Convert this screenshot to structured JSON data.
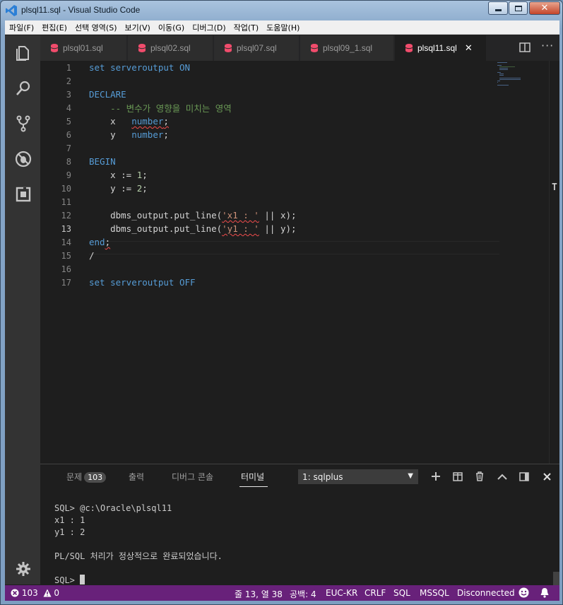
{
  "window": {
    "title": "plsql11.sql - Visual Studio Code"
  },
  "menu": [
    "파일(F)",
    "편집(E)",
    "선택 영역(S)",
    "보기(V)",
    "이동(G)",
    "디버그(D)",
    "작업(T)",
    "도움말(H)"
  ],
  "tabs": [
    {
      "label": "plsql01.sql"
    },
    {
      "label": "plsql02.sql"
    },
    {
      "label": "plsql07.sql"
    },
    {
      "label": "plsql09_1.sql"
    },
    {
      "label": "plsql11.sql",
      "close": "✕"
    }
  ],
  "editor": {
    "current_line": 13,
    "line_numbers": [
      "1",
      "2",
      "3",
      "4",
      "5",
      "6",
      "7",
      "8",
      "9",
      "10",
      "11",
      "12",
      "13",
      "14",
      "15",
      "16",
      "17"
    ],
    "l1": {
      "a": "set serveroutput ",
      "b": "ON"
    },
    "l3": "DECLARE",
    "l4": "-- 변수가 영향을 미치는 영역",
    "l5": {
      "a": "x   ",
      "b": "number",
      "c": ";"
    },
    "l6": {
      "a": "y   ",
      "b": "number",
      "c": ";"
    },
    "l8": "BEGIN",
    "l9": {
      "a": "x := ",
      "b": "1",
      "c": ";"
    },
    "l10": {
      "a": "y := ",
      "b": "2",
      "c": ";"
    },
    "l12": {
      "a": "dbms_output.put_line(",
      "b": "'x1 : '",
      "c": " || x);"
    },
    "l13": {
      "a": "dbms_output.put_line(",
      "b": "'y1 : '",
      "c": " || y);"
    },
    "l14": {
      "a": "end",
      "b": ";"
    },
    "l15": "/",
    "l17": {
      "a": "set serveroutput ",
      "b": "OFF"
    }
  },
  "panel": {
    "tabs": {
      "problems": "문제",
      "problems_count": "103",
      "output": "출력",
      "debug_console": "디버그 콘솔",
      "terminal": "터미널"
    },
    "terminal_select": "1: sqlplus",
    "terminal_lines": [
      "SQL> @c:\\Oracle\\plsql11",
      "x1 : 1",
      "y1 : 2",
      "",
      "PL/SQL 처리가 정상적으로 완료되었습니다.",
      ""
    ],
    "prompt": "SQL> "
  },
  "status": {
    "errors": "103",
    "warnings": "0",
    "position": "줄 13, 열 38",
    "indent": "공백: 4",
    "encoding": "EUC-KR",
    "eol": "CRLF",
    "language": "SQL",
    "server": "MSSQL",
    "connection": "Disconnected"
  },
  "colors": {
    "status_bar": "#68217a",
    "keyword": "#569cd6",
    "comment": "#6a9955",
    "string": "#ce9178",
    "number": "#b5cea8",
    "tab_db_icon": "#f14c6c"
  }
}
